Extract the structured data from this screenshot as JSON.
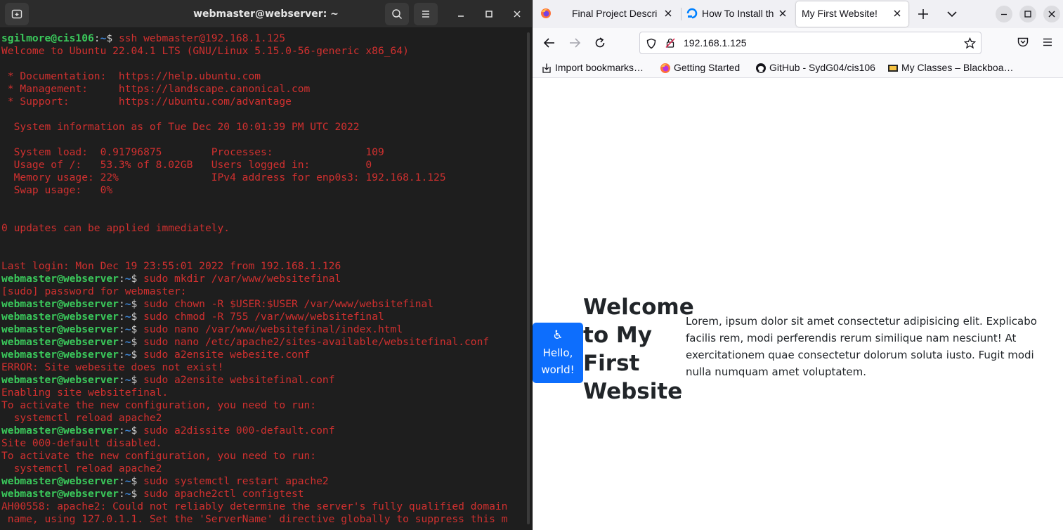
{
  "terminal": {
    "title": "webmaster@webserver: ~",
    "lines": [
      {
        "user": "sgilmore@cis106",
        "path": "~",
        "cmd": "ssh webmaster@192.168.1.125"
      },
      {
        "text": "Welcome to Ubuntu 22.04.1 LTS (GNU/Linux 5.15.0-56-generic x86_64)"
      },
      {
        "text": ""
      },
      {
        "text": " * Documentation:  https://help.ubuntu.com"
      },
      {
        "text": " * Management:     https://landscape.canonical.com"
      },
      {
        "text": " * Support:        https://ubuntu.com/advantage"
      },
      {
        "text": ""
      },
      {
        "text": "  System information as of Tue Dec 20 10:01:39 PM UTC 2022"
      },
      {
        "text": ""
      },
      {
        "text": "  System load:  0.91796875        Processes:               109"
      },
      {
        "text": "  Usage of /:   53.3% of 8.02GB   Users logged in:         0"
      },
      {
        "text": "  Memory usage: 22%               IPv4 address for enp0s3: 192.168.1.125"
      },
      {
        "text": "  Swap usage:   0%"
      },
      {
        "text": ""
      },
      {
        "text": ""
      },
      {
        "text": "0 updates can be applied immediately."
      },
      {
        "text": ""
      },
      {
        "text": ""
      },
      {
        "text": "Last login: Mon Dec 19 23:55:01 2022 from 192.168.1.126"
      },
      {
        "user": "webmaster@webserver",
        "path": "~",
        "cmd": "sudo mkdir /var/www/websitefinal"
      },
      {
        "text": "[sudo] password for webmaster:"
      },
      {
        "user": "webmaster@webserver",
        "path": "~",
        "cmd": "sudo chown -R $USER:$USER /var/www/websitefinal"
      },
      {
        "user": "webmaster@webserver",
        "path": "~",
        "cmd": "sudo chmod -R 755 /var/www/websitefinal"
      },
      {
        "user": "webmaster@webserver",
        "path": "~",
        "cmd": "sudo nano /var/www/websitefinal/index.html"
      },
      {
        "user": "webmaster@webserver",
        "path": "~",
        "cmd": "sudo nano /etc/apache2/sites-available/websitefinal.conf"
      },
      {
        "user": "webmaster@webserver",
        "path": "~",
        "cmd": "sudo a2ensite webesite.conf"
      },
      {
        "text": "ERROR: Site webesite does not exist!"
      },
      {
        "user": "webmaster@webserver",
        "path": "~",
        "cmd": "sudo a2ensite websitefinal.conf"
      },
      {
        "text": "Enabling site websitefinal."
      },
      {
        "text": "To activate the new configuration, you need to run:"
      },
      {
        "text": "  systemctl reload apache2"
      },
      {
        "user": "webmaster@webserver",
        "path": "~",
        "cmd": "sudo a2dissite 000-default.conf"
      },
      {
        "text": "Site 000-default disabled."
      },
      {
        "text": "To activate the new configuration, you need to run:"
      },
      {
        "text": "  systemctl reload apache2"
      },
      {
        "user": "webmaster@webserver",
        "path": "~",
        "cmd": "sudo systemctl restart apache2"
      },
      {
        "user": "webmaster@webserver",
        "path": "~",
        "cmd": "sudo apache2ctl configtest"
      },
      {
        "text": "AH00558: apache2: Could not reliably determine the server's fully qualified domain"
      },
      {
        "text": " name, using 127.0.1.1. Set the 'ServerName' directive globally to suppress this m"
      }
    ]
  },
  "browser": {
    "tabs": [
      {
        "label": "Final Project Descri",
        "icon": "document-icon"
      },
      {
        "label": "How To Install th",
        "icon": "digitalocean-icon"
      },
      {
        "label": "My First Website!",
        "icon": "none",
        "active": true
      }
    ],
    "url": "192.168.1.125",
    "bookmarks": [
      {
        "label": "Import bookmarks…",
        "icon": "import-icon"
      },
      {
        "label": "Getting Started",
        "icon": "firefox-icon"
      },
      {
        "label": "GitHub - SydG04/cis106",
        "icon": "github-icon"
      },
      {
        "label": "My Classes – Blackboa…",
        "icon": "blackboard-icon"
      }
    ],
    "page": {
      "button_icon": "♿",
      "button_label": "Hello, world!",
      "heading": "Welcome to My First Website",
      "paragraph": "Lorem, ipsum dolor sit amet consectetur adipisicing elit. Explicabo facilis rem, modi perferendis rerum similique nam nesciunt! At exercitationem quae consectetur dolorum soluta iusto. Fugit modi nulla numquam amet voluptatem.",
      "button_color": "#0d6efd"
    }
  },
  "colors": {
    "terminal_bg": "#1e1e1e",
    "terminal_text": "#d0302f",
    "prompt_user": "#3ac85b",
    "prompt_path": "#3f87d6"
  }
}
